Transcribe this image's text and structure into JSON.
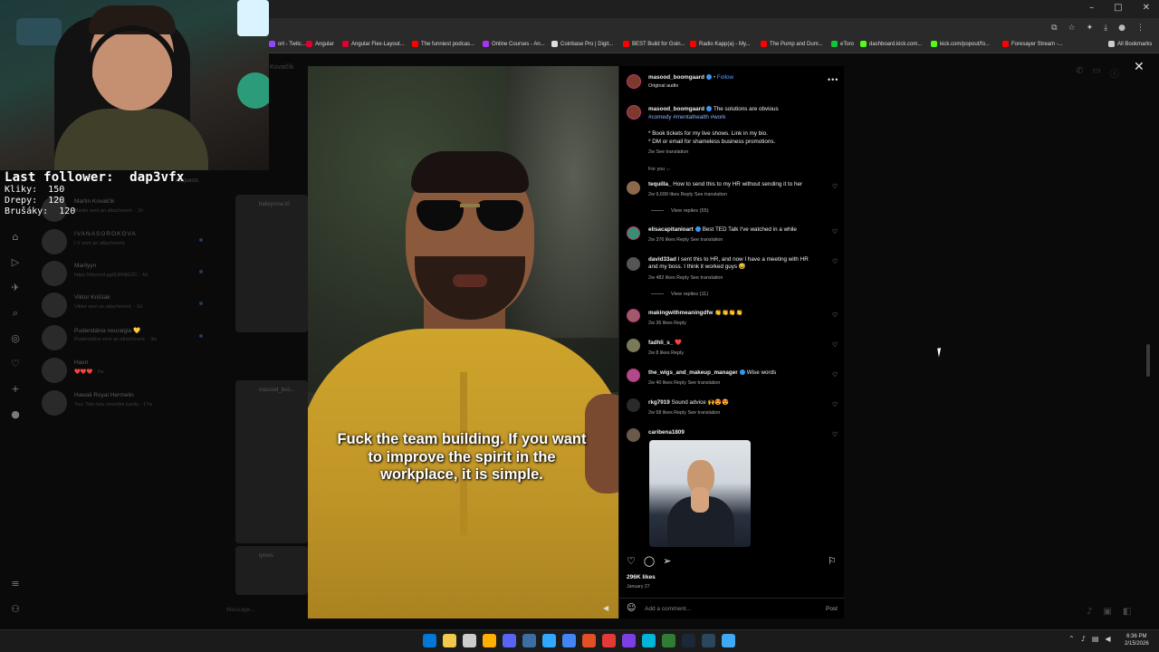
{
  "browser": {
    "window_controls": [
      "–",
      "□",
      "✕"
    ],
    "bookmarks": [
      {
        "label": "ort - Twitc...",
        "color": "#9146ff"
      },
      {
        "label": "Angular",
        "color": "#dd0031"
      },
      {
        "label": "Angular Flex-Layout...",
        "color": "#dd0031"
      },
      {
        "label": "The funniest podcas...",
        "color": "#ff0000"
      },
      {
        "label": "Online Courses - An...",
        "color": "#a435f0"
      },
      {
        "label": "Coinbase Pro | Digit...",
        "color": "#dddddd"
      },
      {
        "label": "BEST Build for Goin...",
        "color": "#ff0000"
      },
      {
        "label": "Radio Kapp(a) - My...",
        "color": "#ff0000"
      },
      {
        "label": "The Pump and Dum...",
        "color": "#ff0000"
      },
      {
        "label": "eToro",
        "color": "#13c636"
      },
      {
        "label": "dashboard.kick.com...",
        "color": "#53fc18"
      },
      {
        "label": "kick.com/popout/fo...",
        "color": "#53fc18"
      },
      {
        "label": "Foresayer Stream -...",
        "color": "#ff0000"
      },
      {
        "label": "All Bookmarks",
        "color": "#cccccc"
      }
    ]
  },
  "stream_overlay": {
    "last_follower_label": "Last follower:",
    "last_follower_name": "dap3vfx",
    "stats": [
      {
        "label": "Kliky:",
        "value": "150"
      },
      {
        "label": "Drepy:",
        "value": "120"
      },
      {
        "label": "Brušáky:",
        "value": "120"
      }
    ]
  },
  "instagram_bg": {
    "header_name": "Kovalčík",
    "requests": "Requests",
    "dms": [
      {
        "name": "Martin Kovalčík",
        "msg": "Martin sent an attachment. · 1h"
      },
      {
        "name": "IVANASOROKOVA",
        "msg": "I V sent an attachment."
      },
      {
        "name": "Marllyyn",
        "msg": "https://discord.gg/8JKNtGZC · 4d"
      },
      {
        "name": "Viktor Kriššák",
        "msg": "Viktor sent an attachment. · 1d"
      },
      {
        "name": "Pudendálna neuralgia 💛",
        "msg": "Pudendálna sent an attachment. · 3w"
      },
      {
        "name": "Havri",
        "msg": "❤️❤️❤️ · 2w"
      },
      {
        "name": "Hawaii Royal Hermelin",
        "msg": "You: Toto tela nevedim kazdy · 17w"
      }
    ],
    "thumb_users": [
      "baileyrose.irl",
      "masood_boo...",
      "tyrexs"
    ],
    "message_placeholder": "Message..."
  },
  "video": {
    "subtitle": "Fuck the team building. If you want to improve the spirit in the workplace, it is simple."
  },
  "post": {
    "author": "masood_boomgaard",
    "follow": "Follow",
    "audio": "Original audio",
    "caption_author": "masood_boomgaard",
    "caption_text": "The solutions are obvious",
    "hashtags": "#comedy #mentalhealth #work",
    "caption_line2": "* Book tickets for my live shows. Link in my bio.",
    "caption_line3": "* DM or email for shameless business promotions.",
    "caption_meta": "2w   See translation",
    "for_you": "For you ⌵",
    "comments": [
      {
        "user": "tequilla_",
        "text": "How to send this to my HR without sending it to her",
        "meta": "2w   9,699 likes   Reply   See translation",
        "replies": "View replies (55)"
      },
      {
        "user": "elisacapitanioart",
        "text": "Best TED Talk I've watched in a while",
        "meta": "2w   376 likes   Reply   See translation"
      },
      {
        "user": "david33ad",
        "text": "I sent this to HR, and now I have a meeting with HR",
        "text2": "and my boss. I think it worked guys 😅",
        "meta": "2w   482 likes   Reply   See translation",
        "replies": "View replies (11)"
      },
      {
        "user": "makingwithmeaningdfw",
        "text": "👏👏👏👏",
        "meta": "2w   36 likes   Reply"
      },
      {
        "user": "fadhli_s_",
        "text": "❤️",
        "meta": "2w   8 likes   Reply"
      },
      {
        "user": "the_wigs_and_makeup_manager",
        "text": "Wise words",
        "meta": "2w   40 likes   Reply   See translation"
      },
      {
        "user": "rkg7919",
        "text": "Sound advice 🙌😍😍",
        "meta": "2w   58 likes   Reply   See translation"
      },
      {
        "user": "caribena1809",
        "text": ""
      }
    ],
    "likes": "296K likes",
    "date": "January 27",
    "add_comment": "Add a comment...",
    "post_button": "Post"
  },
  "taskbar": {
    "time": "6:36 PM",
    "date": "2/15/2026",
    "icons": [
      "#0078d4",
      "#f2c94c",
      "#cccccc",
      "#ffb000",
      "#5865f2",
      "#3b6ea5",
      "#31a8ff",
      "#4285f4",
      "#e34f26",
      "#e53935",
      "#7b3fe4",
      "#00b4d8",
      "#2e7d32",
      "#1b2838",
      "#2a475e",
      "#3fa9f5"
    ]
  }
}
